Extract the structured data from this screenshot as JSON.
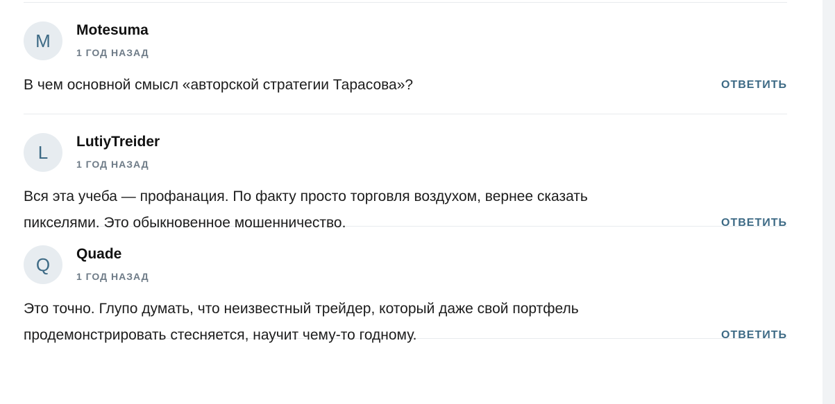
{
  "comments": [
    {
      "initial": "M",
      "author": "Motesuma",
      "time": "1 ГОД НАЗАД",
      "text": "В чем основной смысл «авторской стратегии Тарасова»?",
      "reply_label": "ОТВЕТИТЬ"
    },
    {
      "initial": "L",
      "author": "LutiyTreider",
      "time": "1 ГОД НАЗАД",
      "text": "Вся эта учеба — профанация. По факту просто торговля воздухом, вернее сказать пикселями. Это обыкновенное мошенничество.",
      "reply_label": "ОТВЕТИТЬ"
    },
    {
      "initial": "Q",
      "author": "Quade",
      "time": "1 ГОД НАЗАД",
      "text": "Это точно. Глупо думать, что неизвестный трейдер, который даже свой портфель продемонстрировать стесняется, научит чему-то годному.",
      "reply_label": "ОТВЕТИТЬ"
    }
  ]
}
